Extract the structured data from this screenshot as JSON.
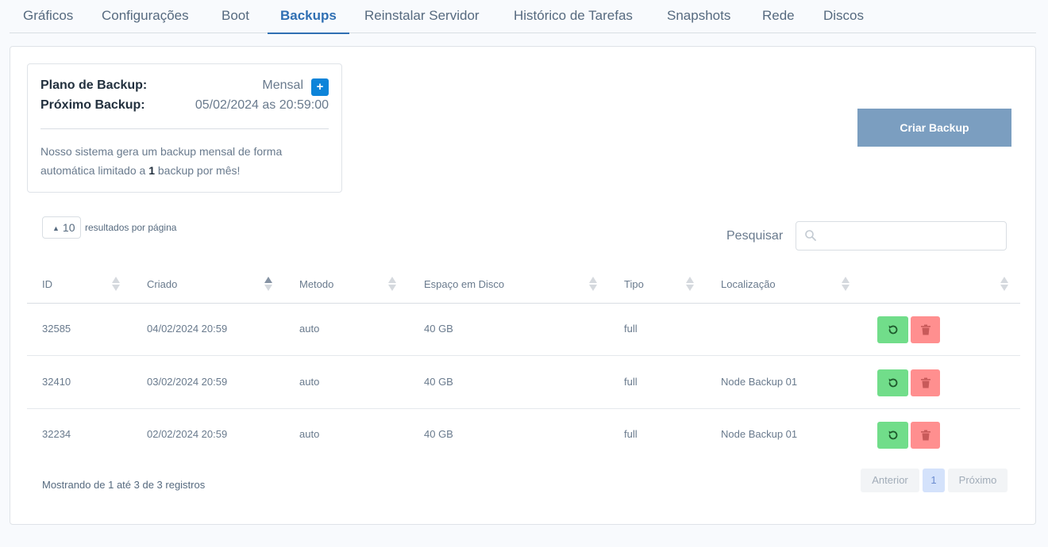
{
  "tabs": [
    {
      "label": "Gráficos"
    },
    {
      "label": "Configurações"
    },
    {
      "label": "Boot"
    },
    {
      "label": "Backups"
    },
    {
      "label": "Reinstalar Servidor"
    },
    {
      "label": "Histórico de Tarefas"
    },
    {
      "label": "Snapshots"
    },
    {
      "label": "Rede"
    },
    {
      "label": "Discos"
    }
  ],
  "active_tab": "Backups",
  "plan": {
    "plan_label": "Plano de Backup:",
    "plan_value": "Mensal",
    "add_label": "+",
    "next_label": "Próximo Backup:",
    "next_value": "05/02/2024 as 20:59:00",
    "desc_before": "Nosso sistema gera um backup mensal de forma automática limitado a ",
    "desc_bold": "1",
    "desc_after": " backup por mês!"
  },
  "create_button": "Criar Backup",
  "per_page": {
    "value": "10",
    "label": "resultados por página"
  },
  "search": {
    "label": "Pesquisar",
    "placeholder": ""
  },
  "table": {
    "columns": [
      "ID",
      "Criado",
      "Metodo",
      "Espaço em Disco",
      "Tipo",
      "Localização"
    ],
    "rows": [
      {
        "id": "32585",
        "created": "04/02/2024 20:59",
        "method": "auto",
        "disk": "40 GB",
        "type": "full",
        "location": ""
      },
      {
        "id": "32410",
        "created": "03/02/2024 20:59",
        "method": "auto",
        "disk": "40 GB",
        "type": "full",
        "location": "Node Backup 01"
      },
      {
        "id": "32234",
        "created": "02/02/2024 20:59",
        "method": "auto",
        "disk": "40 GB",
        "type": "full",
        "location": "Node Backup 01"
      }
    ]
  },
  "footer": {
    "info": "Mostrando de 1 até 3 de 3 registros",
    "prev": "Anterior",
    "page": "1",
    "next": "Próximo"
  },
  "colors": {
    "accent": "#2f6fb3",
    "restore": "#71dd8a",
    "delete": "#ff8f8f",
    "create": "#7b9ec0"
  },
  "icons": {
    "restore": "rotate-ccw-icon",
    "delete": "trash-icon",
    "search": "search-icon",
    "sort": "sort-icon"
  }
}
